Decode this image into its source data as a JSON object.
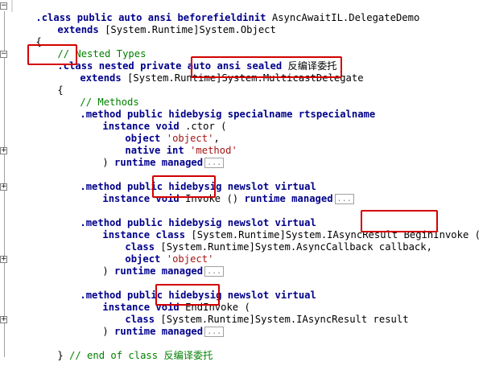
{
  "code": {
    "l1_a": ".class public auto ansi beforefieldinit ",
    "l1_b": "AsyncAwaitIL.DelegateDemo",
    "l2_a": "extends ",
    "l2_b": "[System.Runtime]System.Object",
    "l3": "{",
    "l4": "// Nested Types",
    "l5_a": ".class",
    "l5_b": " nested private auto ansi sealed ",
    "l5_c": "反编译委托",
    "l6_a": "extends ",
    "l6_b": "[System.Runtime]",
    "l6_c": "System.MulticastDelegate",
    "l7": "{",
    "l8": "// Methods",
    "l9": ".method public hidebysig specialname rtspecialname",
    "l10_a": "instance void ",
    "l10_b": ".ctor (",
    "l11_a": "object ",
    "l11_b": "'object'",
    "l11_c": ",",
    "l12_a": "native int ",
    "l12_b": "'method'",
    "l13_a": ") ",
    "l13_b": "runtime managed",
    "l15": ".method public hidebysig newslot virtual",
    "l16_a": "instance void ",
    "l16_b": "Invoke ()",
    "l16_c": " runtime managed",
    "l18": ".method public hidebysig newslot virtual",
    "l19_a": "instance class ",
    "l19_b": "[System.Runtime]System.IAsyncResult ",
    "l19_c": "BeginInvoke (",
    "l20_a": "class ",
    "l20_b": "[System.Runtime]System.AsyncCallback callback,",
    "l21_a": "object ",
    "l21_b": "'object'",
    "l22_a": ") ",
    "l22_b": "runtime managed",
    "l24": ".method public hidebysig newslot virtual",
    "l25_a": "instance void ",
    "l25_b": "EndInvoke (",
    "l26_a": "class ",
    "l26_b": "[System.Runtime]System.IAsyncResult result",
    "l27_a": ") ",
    "l27_b": "runtime managed",
    "l29_a": "} ",
    "l29_b": "// end of class 反编译委托",
    "ellipsis": "..."
  },
  "gutter": {
    "fold_expanded": "−",
    "fold_collapsed": "+"
  },
  "colors": {
    "keyword": "#00008b",
    "comment": "#008000",
    "string": "#a31515",
    "highlight": "#d40000"
  }
}
